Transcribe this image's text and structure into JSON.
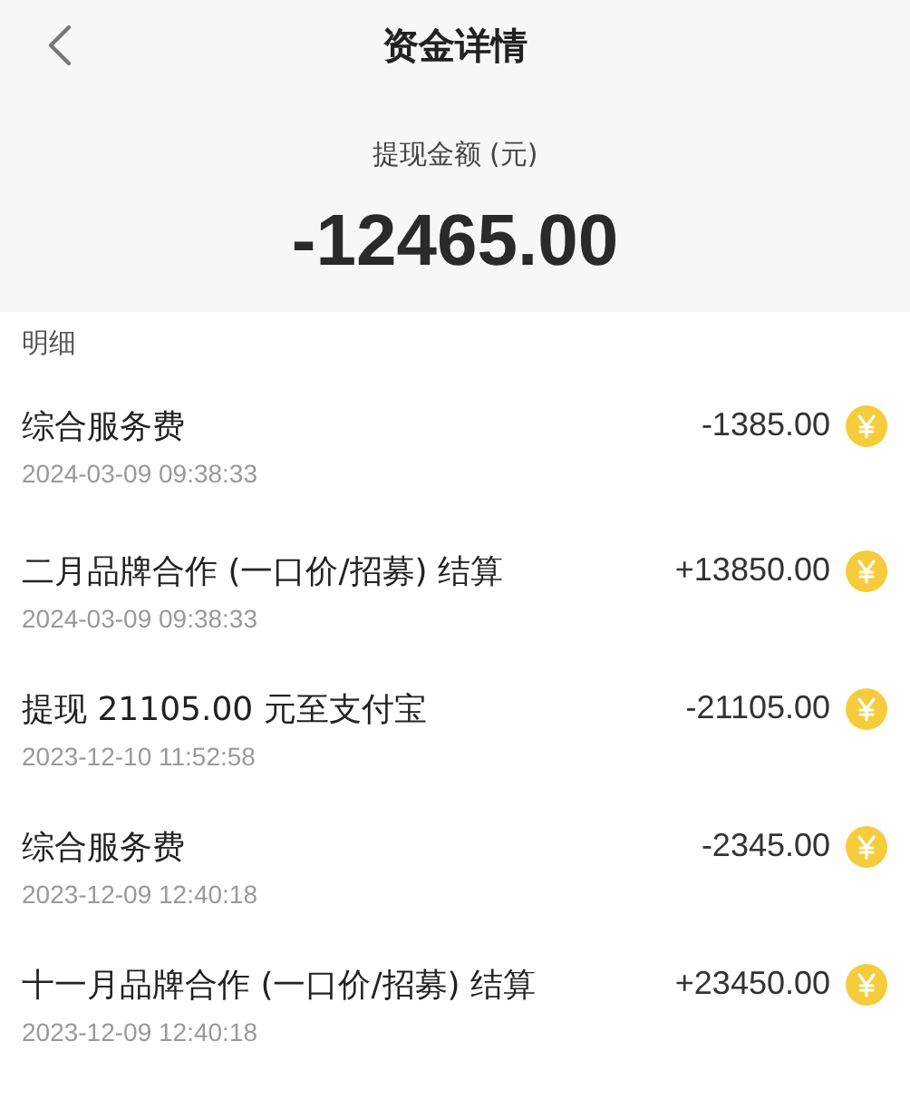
{
  "nav": {
    "title": "资金详情"
  },
  "summary": {
    "label": "提现金额 (元)",
    "amount": "-12465.00"
  },
  "section_title": "明细",
  "records": [
    {
      "title": "综合服务费",
      "time": "2024-03-09 09:38:33",
      "amount": "-1385.00"
    },
    {
      "title": "二月品牌合作 (一口价/招募) 结算",
      "time": "2024-03-09 09:38:33",
      "amount": "+13850.00"
    },
    {
      "title": "提现 21105.00 元至支付宝",
      "time": "2023-12-10 11:52:58",
      "amount": "-21105.00"
    },
    {
      "title": "综合服务费",
      "time": "2023-12-09 12:40:18",
      "amount": "-2345.00"
    },
    {
      "title": "十一月品牌合作 (一口价/招募) 结算",
      "time": "2023-12-09 12:40:18",
      "amount": "+23450.00"
    }
  ]
}
